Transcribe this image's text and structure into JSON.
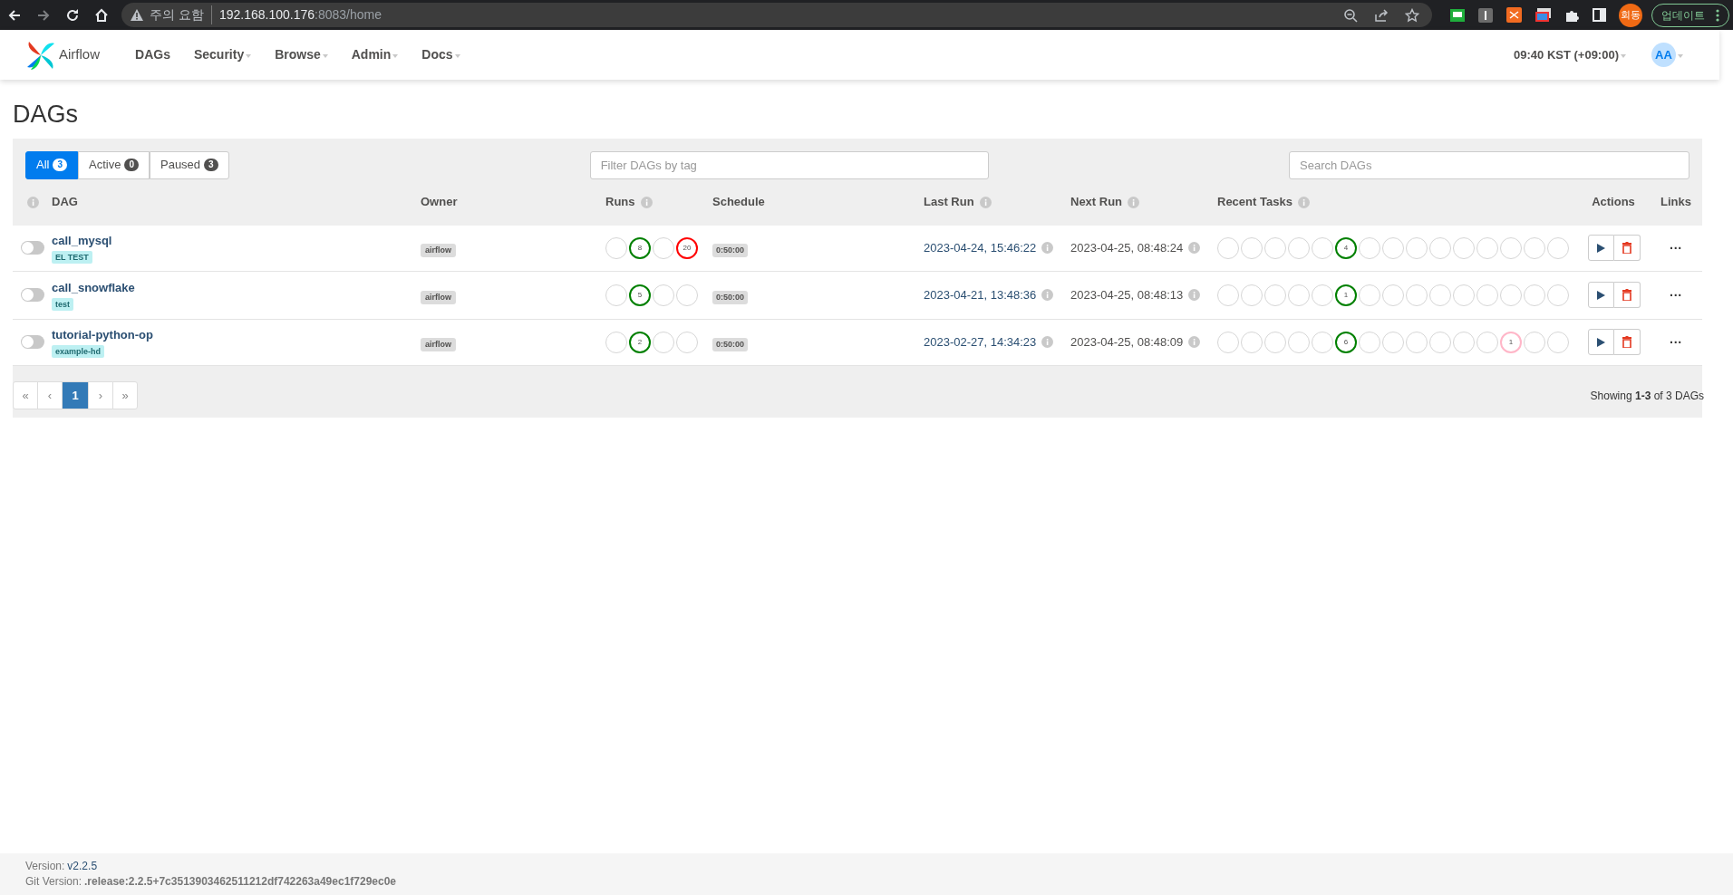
{
  "browser": {
    "security_label": "주의 요함",
    "host": "192.168.100.176",
    "path": ":8083/home",
    "profile": "회동",
    "update_button": "업데이트"
  },
  "nav": {
    "brand": "Airflow",
    "items": [
      {
        "label": "DAGs",
        "dropdown": false
      },
      {
        "label": "Security",
        "dropdown": true
      },
      {
        "label": "Browse",
        "dropdown": true
      },
      {
        "label": "Admin",
        "dropdown": true
      },
      {
        "label": "Docs",
        "dropdown": true
      }
    ],
    "time": "09:40 KST (+09:00)",
    "user": "AA"
  },
  "page_title": "DAGs",
  "filter_tabs": [
    {
      "label": "All",
      "count": "3",
      "selected": true
    },
    {
      "label": "Active",
      "count": "0",
      "selected": false
    },
    {
      "label": "Paused",
      "count": "3",
      "selected": false
    }
  ],
  "tag_filter": {
    "placeholder": "Filter DAGs by tag"
  },
  "search": {
    "placeholder": "Search DAGs"
  },
  "columns": [
    {
      "info": true
    },
    {
      "label": "DAG",
      "info": false
    },
    {
      "label": "Owner",
      "info": false
    },
    {
      "label": "Runs",
      "info": true
    },
    {
      "label": "Schedule",
      "info": false
    },
    {
      "label": "Last Run",
      "info": true
    },
    {
      "label": "Next Run",
      "info": true
    },
    {
      "label": "Recent Tasks",
      "info": true
    },
    {
      "label": "Actions",
      "info": false
    },
    {
      "label": "Links",
      "info": false
    }
  ],
  "rows": [
    {
      "on": false,
      "name": "call_mysql",
      "tags": [
        "EL TEST"
      ],
      "owner": "airflow",
      "runs": [
        {
          "kind": "none"
        },
        {
          "kind": "success",
          "count": "8"
        },
        {
          "kind": "none"
        },
        {
          "kind": "failed",
          "count": "20"
        }
      ],
      "schedule": "0:50:00",
      "last_run": "2023-04-24, 15:46:22",
      "next_run": "2023-04-25, 08:48:24",
      "recent_tasks": [
        {
          "kind": "none"
        },
        {
          "kind": "none"
        },
        {
          "kind": "none"
        },
        {
          "kind": "none"
        },
        {
          "kind": "none"
        },
        {
          "kind": "success",
          "count": "4"
        },
        {
          "kind": "none"
        },
        {
          "kind": "none"
        },
        {
          "kind": "none"
        },
        {
          "kind": "none"
        },
        {
          "kind": "none"
        },
        {
          "kind": "none"
        },
        {
          "kind": "none"
        },
        {
          "kind": "none"
        },
        {
          "kind": "none"
        }
      ],
      "links": "···"
    },
    {
      "on": false,
      "name": "call_snowflake",
      "tags": [
        "test"
      ],
      "owner": "airflow",
      "runs": [
        {
          "kind": "none"
        },
        {
          "kind": "success",
          "count": "5"
        },
        {
          "kind": "none"
        },
        {
          "kind": "none"
        }
      ],
      "schedule": "0:50:00",
      "last_run": "2023-04-21, 13:48:36",
      "next_run": "2023-04-25, 08:48:13",
      "recent_tasks": [
        {
          "kind": "none"
        },
        {
          "kind": "none"
        },
        {
          "kind": "none"
        },
        {
          "kind": "none"
        },
        {
          "kind": "none"
        },
        {
          "kind": "success",
          "count": "1"
        },
        {
          "kind": "none"
        },
        {
          "kind": "none"
        },
        {
          "kind": "none"
        },
        {
          "kind": "none"
        },
        {
          "kind": "none"
        },
        {
          "kind": "none"
        },
        {
          "kind": "none"
        },
        {
          "kind": "none"
        },
        {
          "kind": "none"
        }
      ],
      "links": "···"
    },
    {
      "on": false,
      "name": "tutorial-python-op",
      "tags": [
        "example-hd"
      ],
      "owner": "airflow",
      "runs": [
        {
          "kind": "none"
        },
        {
          "kind": "success",
          "count": "2"
        },
        {
          "kind": "none"
        },
        {
          "kind": "none"
        }
      ],
      "schedule": "0:50:00",
      "last_run": "2023-02-27, 14:34:23",
      "next_run": "2023-04-25, 08:48:09",
      "recent_tasks": [
        {
          "kind": "none"
        },
        {
          "kind": "none"
        },
        {
          "kind": "none"
        },
        {
          "kind": "none"
        },
        {
          "kind": "none"
        },
        {
          "kind": "success",
          "count": "6"
        },
        {
          "kind": "none"
        },
        {
          "kind": "none"
        },
        {
          "kind": "none"
        },
        {
          "kind": "none"
        },
        {
          "kind": "none"
        },
        {
          "kind": "none"
        },
        {
          "kind": "skipped",
          "count": "1"
        },
        {
          "kind": "none"
        },
        {
          "kind": "none"
        }
      ],
      "links": "···"
    }
  ],
  "pagination": [
    {
      "label": "«",
      "selected": false
    },
    {
      "label": "‹",
      "selected": false
    },
    {
      "label": "1",
      "selected": true
    },
    {
      "label": "›",
      "selected": false
    },
    {
      "label": "»",
      "selected": false
    }
  ],
  "showing": "Showing **1-3** of 3 DAGs",
  "footer": {
    "version_label": "Version:",
    "version": "v2.2.5",
    "git_label": "Git Version:",
    "git_version": ".release:2.2.5+7c3513903462511212df742263a49ec1f729ec0e"
  }
}
